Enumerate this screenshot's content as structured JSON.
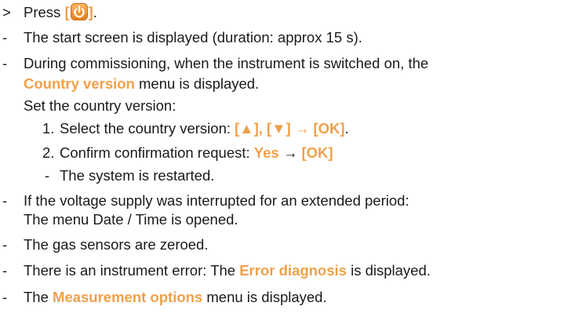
{
  "accent_color": "#f0a04a",
  "step": {
    "marker": ">",
    "text_before": "Press ",
    "bracket_open": "[",
    "icon": "power-icon",
    "bracket_close": "]",
    "text_after": "."
  },
  "results": [
    {
      "marker": "-",
      "text": "The start screen is displayed (duration: approx 15 s)."
    },
    {
      "marker": "-",
      "line1": "During commissioning, when the instrument is switched on, the",
      "highlight": "Country version",
      "line2_after": " menu is displayed."
    },
    {
      "intro": "Set the country version:"
    },
    {
      "num": "1.",
      "text_before": "Select the country version: ",
      "keys": "[▲], [▼] → [OK]",
      "text_after": "."
    },
    {
      "num": "2.",
      "text_before": "Confirm confirmation request: ",
      "highlight": "Yes",
      "arrow": " → ",
      "keys": "[OK]"
    },
    {
      "marker": "-",
      "text": "The system is restarted."
    },
    {
      "marker": "-",
      "line1": "If the voltage supply was interrupted for an extended period:",
      "line2": "The menu Date / Time is opened."
    },
    {
      "marker": "-",
      "text": "The gas sensors are zeroed."
    },
    {
      "marker": "-",
      "text_before": "There is an instrument error: The ",
      "highlight": "Error diagnosis",
      "text_after": " is displayed."
    },
    {
      "marker": "-",
      "text_before": "The ",
      "highlight": "Measurement options",
      "text_after": " menu is displayed."
    }
  ]
}
